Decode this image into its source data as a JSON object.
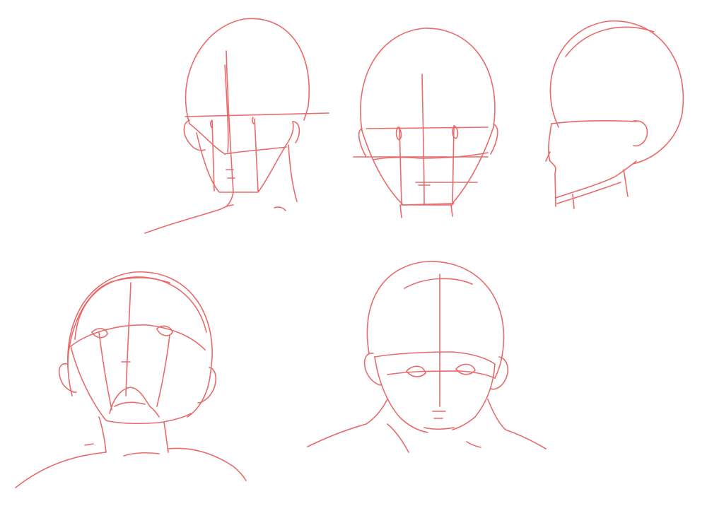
{
  "sheet": {
    "stroke_color": "#e86a6a",
    "background_color": "#ffffff",
    "sketches": [
      "back-view-head",
      "front-view-head",
      "three-quarter-view-head",
      "low-angle-head",
      "high-angle-head"
    ]
  }
}
